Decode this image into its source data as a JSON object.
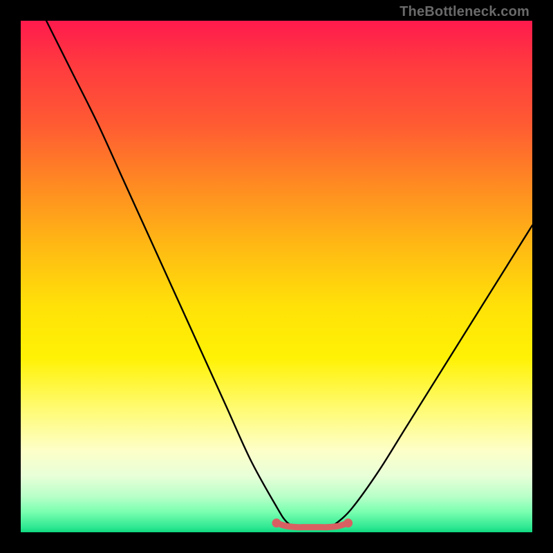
{
  "attribution": "TheBottleneck.com",
  "chart_data": {
    "type": "line",
    "title": "",
    "xlabel": "",
    "ylabel": "",
    "xlim": [
      0,
      100
    ],
    "ylim": [
      0,
      100
    ],
    "grid": false,
    "legend": false,
    "series": [
      {
        "name": "bottleneck-curve",
        "color": "#000000",
        "x": [
          5,
          10,
          15,
          20,
          25,
          30,
          35,
          40,
          45,
          50,
          52,
          54,
          56,
          58,
          60,
          62,
          65,
          70,
          75,
          80,
          85,
          90,
          95,
          100
        ],
        "y": [
          100,
          90,
          80,
          69,
          58,
          47,
          36,
          25,
          14,
          5,
          2,
          1,
          1,
          1,
          1,
          2,
          5,
          12,
          20,
          28,
          36,
          44,
          52,
          60
        ]
      },
      {
        "name": "optimal-segment",
        "color": "#d96062",
        "x": [
          50,
          52,
          54,
          56,
          58,
          60,
          62,
          64
        ],
        "y": [
          1.8,
          1.2,
          1.0,
          1.0,
          1.0,
          1.0,
          1.2,
          1.8
        ]
      }
    ],
    "background_gradient": {
      "stops": [
        {
          "pct": 0,
          "color": "#ff1a4d"
        },
        {
          "pct": 8,
          "color": "#ff3840"
        },
        {
          "pct": 20,
          "color": "#ff5a33"
        },
        {
          "pct": 32,
          "color": "#ff8a22"
        },
        {
          "pct": 44,
          "color": "#ffb914"
        },
        {
          "pct": 56,
          "color": "#ffe208"
        },
        {
          "pct": 66,
          "color": "#fff205"
        },
        {
          "pct": 76,
          "color": "#fffb74"
        },
        {
          "pct": 84,
          "color": "#fdffc8"
        },
        {
          "pct": 89,
          "color": "#e8ffd8"
        },
        {
          "pct": 93,
          "color": "#b8ffc8"
        },
        {
          "pct": 96,
          "color": "#7affb0"
        },
        {
          "pct": 99,
          "color": "#30e892"
        },
        {
          "pct": 100,
          "color": "#10d880"
        }
      ]
    }
  }
}
